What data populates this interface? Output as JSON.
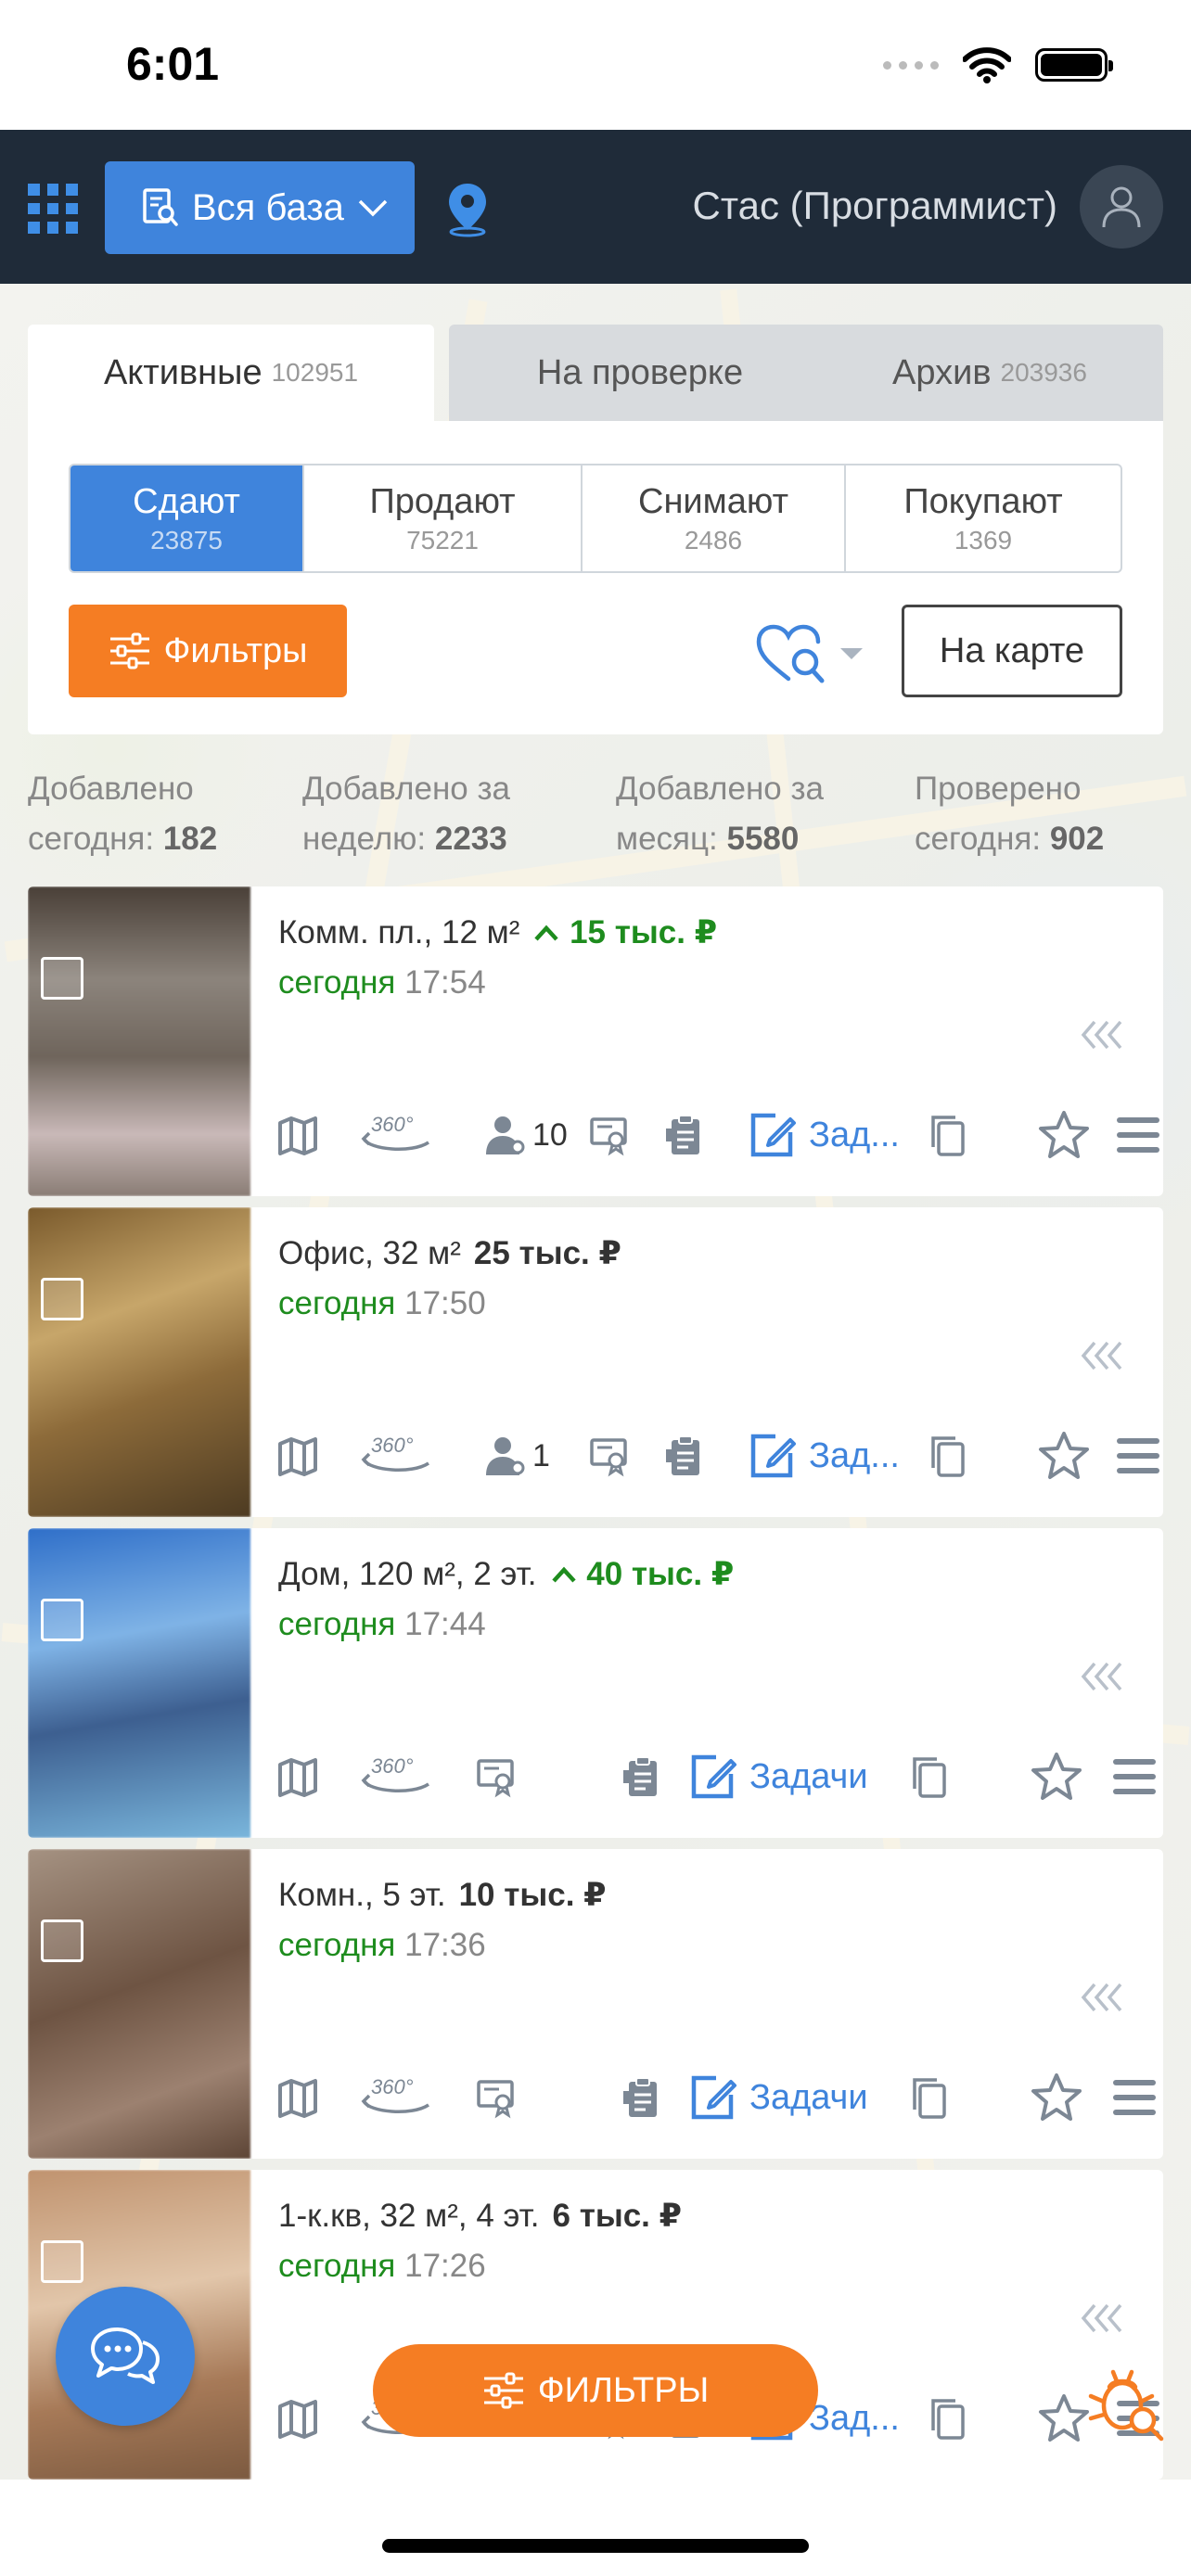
{
  "status": {
    "time": "6:01"
  },
  "header": {
    "db_button_label": "Вся база",
    "user_name": "Стас (Программист)",
    "icons": {
      "menu": "grid-icon",
      "db": "search-document-icon",
      "location": "location-pin-icon",
      "avatar": "user-icon"
    }
  },
  "tabs": [
    {
      "label": "Активные",
      "count": "102951"
    },
    {
      "label": "На проверке",
      "count": ""
    },
    {
      "label": "Архив",
      "count": "203936"
    }
  ],
  "segments": [
    {
      "label": "Сдают",
      "count": "23875"
    },
    {
      "label": "Продают",
      "count": "75221"
    },
    {
      "label": "Снимают",
      "count": "2486"
    },
    {
      "label": "Покупают",
      "count": "1369"
    }
  ],
  "controls": {
    "filters_label": "Фильтры",
    "map_label": "На карте"
  },
  "stats": [
    {
      "line1": "Добавлено",
      "line2": "сегодня: ",
      "value": "182"
    },
    {
      "line1": "Добавлено за",
      "line2": "неделю: ",
      "value": "2233"
    },
    {
      "line1": "Добавлено за",
      "line2": "месяц: ",
      "value": "5580"
    },
    {
      "line1": "Проверено",
      "line2": "сегодня: ",
      "value": "902"
    }
  ],
  "listings": [
    {
      "title": "Комм. пл., 12 м²",
      "price": "15 тыс. ₽",
      "price_trend": "up",
      "date_word": "сегодня",
      "time": "17:54",
      "owners_count": "10",
      "tasks_label": "Зад..."
    },
    {
      "title": "Офис, 32 м²",
      "price": "25 тыс. ₽",
      "price_trend": "none",
      "date_word": "сегодня",
      "time": "17:50",
      "owners_count": "1",
      "tasks_label": "Зад..."
    },
    {
      "title": "Дом, 120 м², 2 эт.",
      "price": "40 тыс. ₽",
      "price_trend": "up",
      "date_word": "сегодня",
      "time": "17:44",
      "owners_count": "",
      "tasks_label": "Задачи"
    },
    {
      "title": "Комн., 5 эт.",
      "price": "10 тыс. ₽",
      "price_trend": "none",
      "date_word": "сегодня",
      "time": "17:36",
      "owners_count": "",
      "tasks_label": "Задачи"
    },
    {
      "title": "1-к.кв, 32 м², 4 эт.",
      "price": "6 тыс. ₽",
      "price_trend": "none",
      "date_word": "сегодня",
      "time": "17:26",
      "owners_count": "",
      "tasks_label": "Зад..."
    }
  ],
  "fab": {
    "filters_label": "ФИЛЬТРЫ"
  },
  "colors": {
    "accent_blue": "#3f84dc",
    "accent_orange": "#f57d23",
    "header_bg": "#1f2b39",
    "price_up_green": "#1e8c1e"
  }
}
